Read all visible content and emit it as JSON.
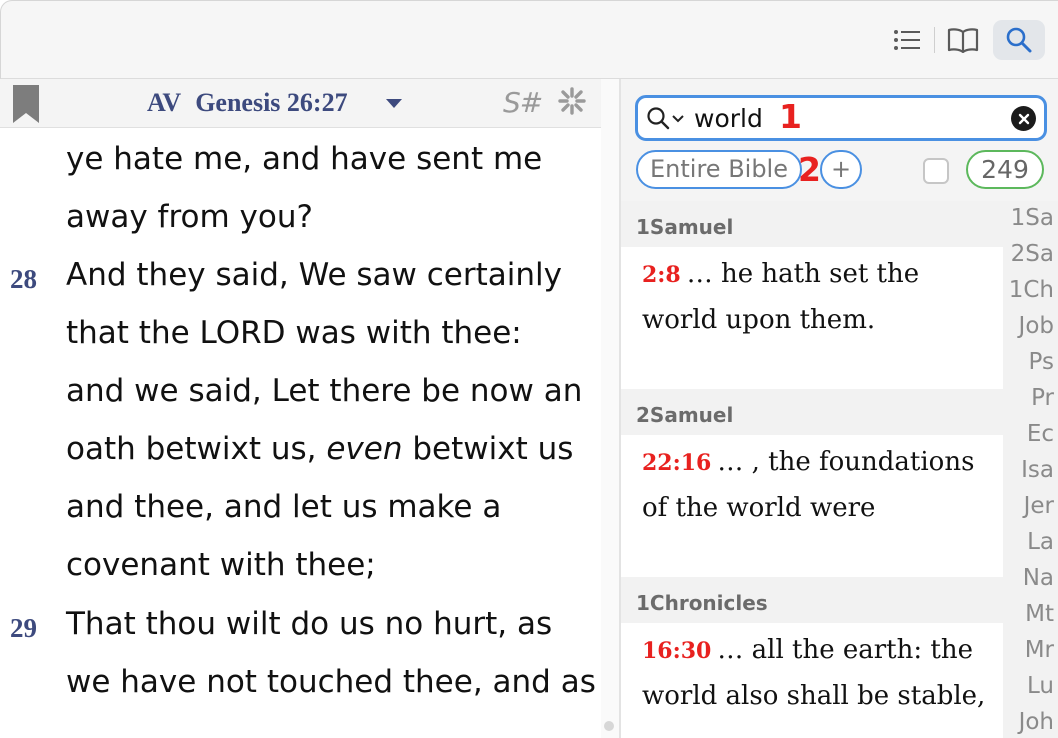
{
  "toolbar": {
    "buttons": [
      "list-icon",
      "book-icon",
      "search-icon"
    ],
    "active_button": "search-icon",
    "active_color": "#2b6fcb"
  },
  "reader": {
    "version": "AV",
    "reference": "Genesis 26:27",
    "strongs_label": "S#",
    "lines": [
      {
        "text": "ye hate me, and have sent me"
      },
      {
        "text": "away from you?"
      },
      {
        "num": "28",
        "text": "And they said, We saw certainly"
      },
      {
        "text": "that the LORD was with thee:"
      },
      {
        "text": "and we said, Let there be now an"
      },
      {
        "pre": "oath betwixt us, ",
        "ital": "even",
        "post": " betwixt us"
      },
      {
        "text": "and thee, and let us make a"
      },
      {
        "text": "covenant with thee;"
      },
      {
        "num": "29",
        "text": "That thou wilt do us no hurt, as"
      },
      {
        "text": "we have not touched thee, and as"
      }
    ],
    "verse_color": "#3d4a7e"
  },
  "search": {
    "query": "world",
    "scope": "Entire Bible",
    "add_label": "+",
    "result_count": "249",
    "annotations": [
      "1",
      "2"
    ],
    "annotation_color": "#e8211f",
    "focus_color": "#4a90e2"
  },
  "results": [
    {
      "book": "1Samuel",
      "ref": "2:8",
      "line1": "… he hath set the",
      "line2": "world upon them."
    },
    {
      "book": "2Samuel",
      "ref": "22:16",
      "line1": "… , the foundations",
      "line2": "of the world were"
    },
    {
      "book": "1Chronicles",
      "ref": "16:30",
      "line1": "… all the earth: the",
      "line2": "world also shall be stable,"
    }
  ],
  "book_index": [
    "1Sa",
    "2Sa",
    "1Ch",
    "Job",
    "Ps",
    "Pr",
    "Ec",
    "Isa",
    "Jer",
    "La",
    "Na",
    "Mt",
    "Mr",
    "Lu",
    "Joh"
  ]
}
